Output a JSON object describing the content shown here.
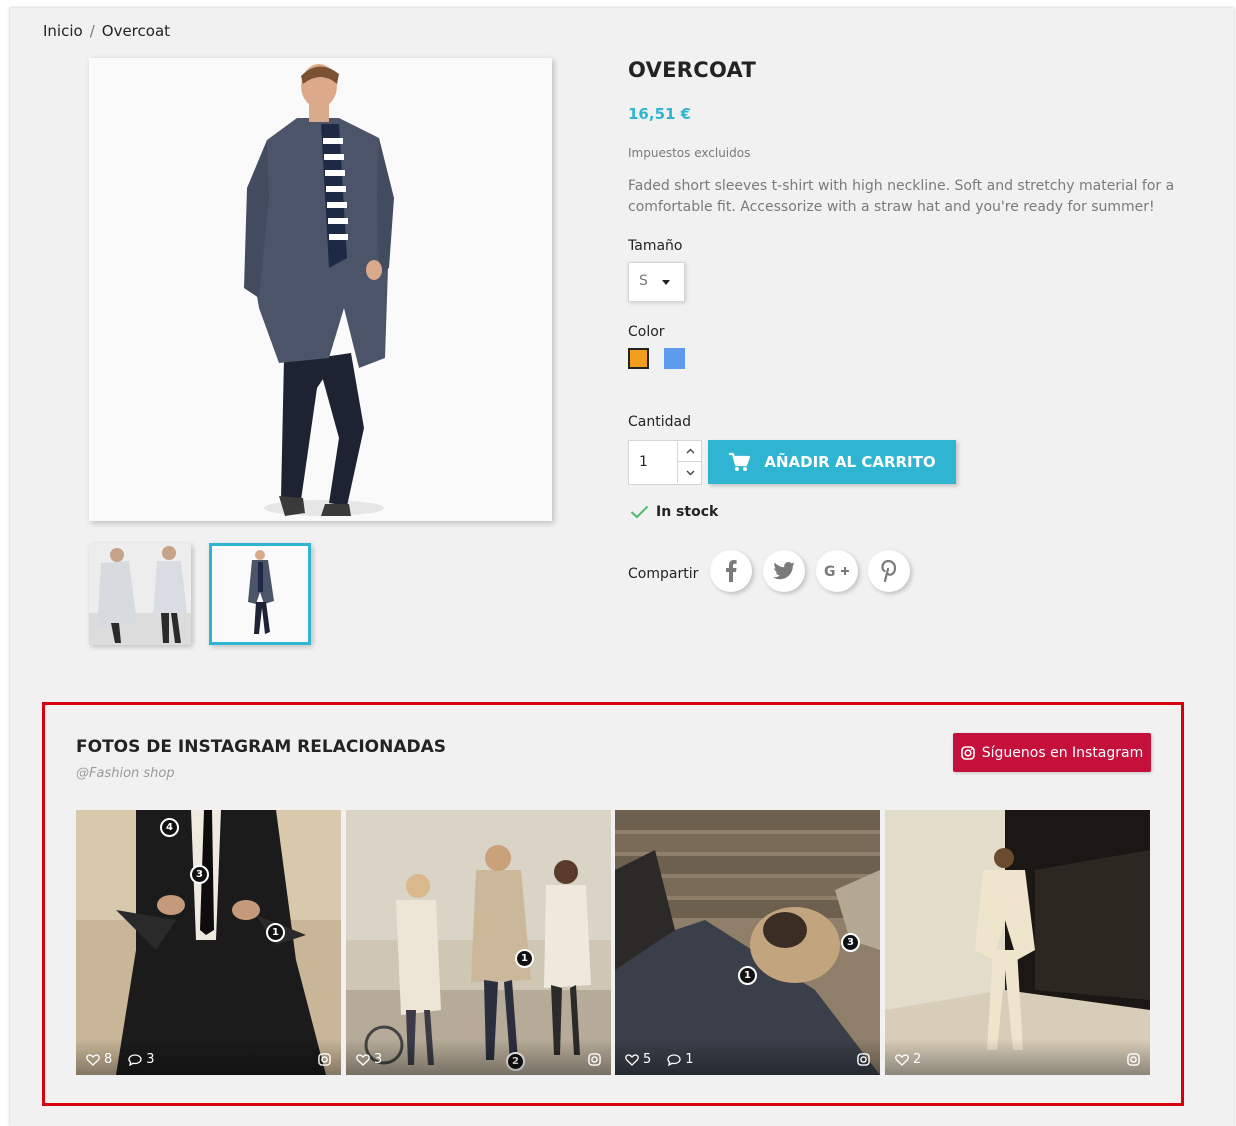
{
  "breadcrumb": {
    "home": "Inicio",
    "separator": "/",
    "current": "Overcoat"
  },
  "product": {
    "title": "OVERCOAT",
    "price": "16,51 €",
    "tax_note": "Impuestos excluidos",
    "description": "Faded short sleeves t-shirt with high neckline. Soft and stretchy material for a comfortable fit. Accessorize with a straw hat and you're ready for summer!",
    "size_label": "Tamaño",
    "size_value": "S",
    "color_label": "Color",
    "colors": [
      "#f39d1d",
      "#5d9cec"
    ],
    "quantity_label": "Cantidad",
    "quantity_value": "1",
    "add_to_cart": "AÑADIR AL CARRITO",
    "stock": "In stock",
    "share_label": "Compartir",
    "accent_color": "#2fb5d2"
  },
  "instagram": {
    "title": "FOTOS DE INSTAGRAM RELACIONADAS",
    "subtitle": "@Fashion shop",
    "follow_button": "Síguenos en Instagram",
    "button_color": "#c4103a",
    "photos": [
      {
        "likes": "8",
        "comments": "3",
        "tags": [
          "4",
          "3",
          "1"
        ]
      },
      {
        "likes": "3",
        "comments": "",
        "tags": [
          "1",
          "2"
        ]
      },
      {
        "likes": "5",
        "comments": "1",
        "tags": [
          "3",
          "1"
        ]
      },
      {
        "likes": "2",
        "comments": "",
        "tags": []
      }
    ]
  }
}
